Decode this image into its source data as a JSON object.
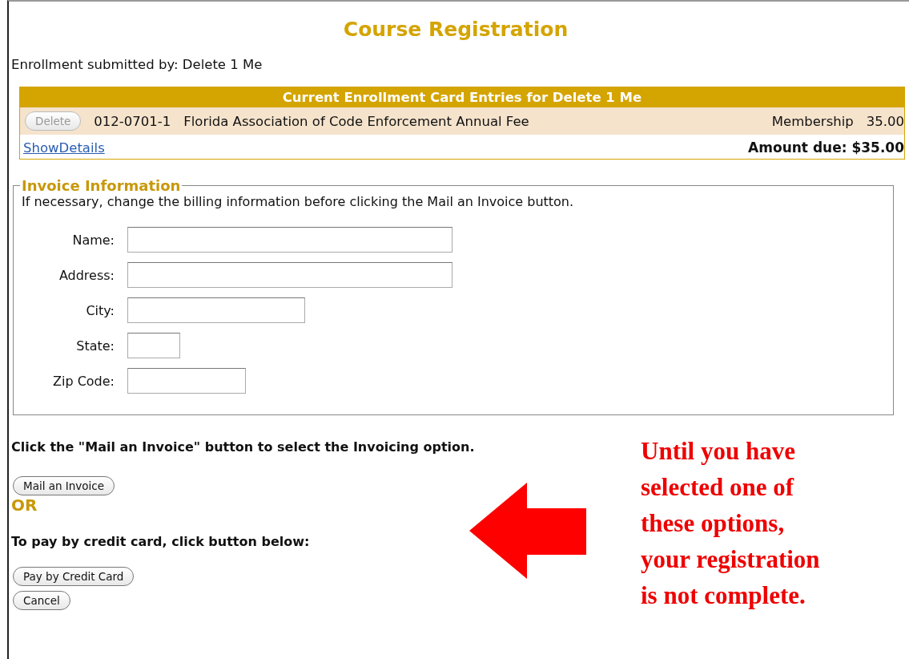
{
  "title": "Course Registration",
  "submitted_by": "Enrollment submitted by: Delete 1 Me",
  "enrollment": {
    "header": "Current Enrollment Card Entries for Delete 1 Me",
    "rows": [
      {
        "button": "Delete",
        "disabled": true,
        "code": "012-0701-1",
        "description": "Florida Association of Code Enforcement Annual Fee",
        "type": "Membership",
        "amount": "35.00"
      }
    ],
    "details_link": "ShowDetails",
    "amount_due": "Amount due: $35.00"
  },
  "invoice": {
    "legend": "Invoice Information",
    "note": "If necessary, change the billing information before clicking the Mail an Invoice button.",
    "fields": [
      {
        "label": "Name:"
      },
      {
        "label": "Address:"
      },
      {
        "label": "City:"
      },
      {
        "label": "State:"
      },
      {
        "label": "Zip Code:"
      }
    ]
  },
  "mail_instruction": "Click the \"Mail an Invoice\" button to select the Invoicing option.",
  "mail_button": "Mail an Invoice",
  "or_label": "OR",
  "card_instruction": "To pay by credit card, click button below:",
  "card_button": "Pay by Credit Card",
  "cancel_button": "Cancel",
  "annotation_lines": [
    "Until you have",
    "selected one of",
    "these options,",
    "your registration",
    "is not complete."
  ]
}
